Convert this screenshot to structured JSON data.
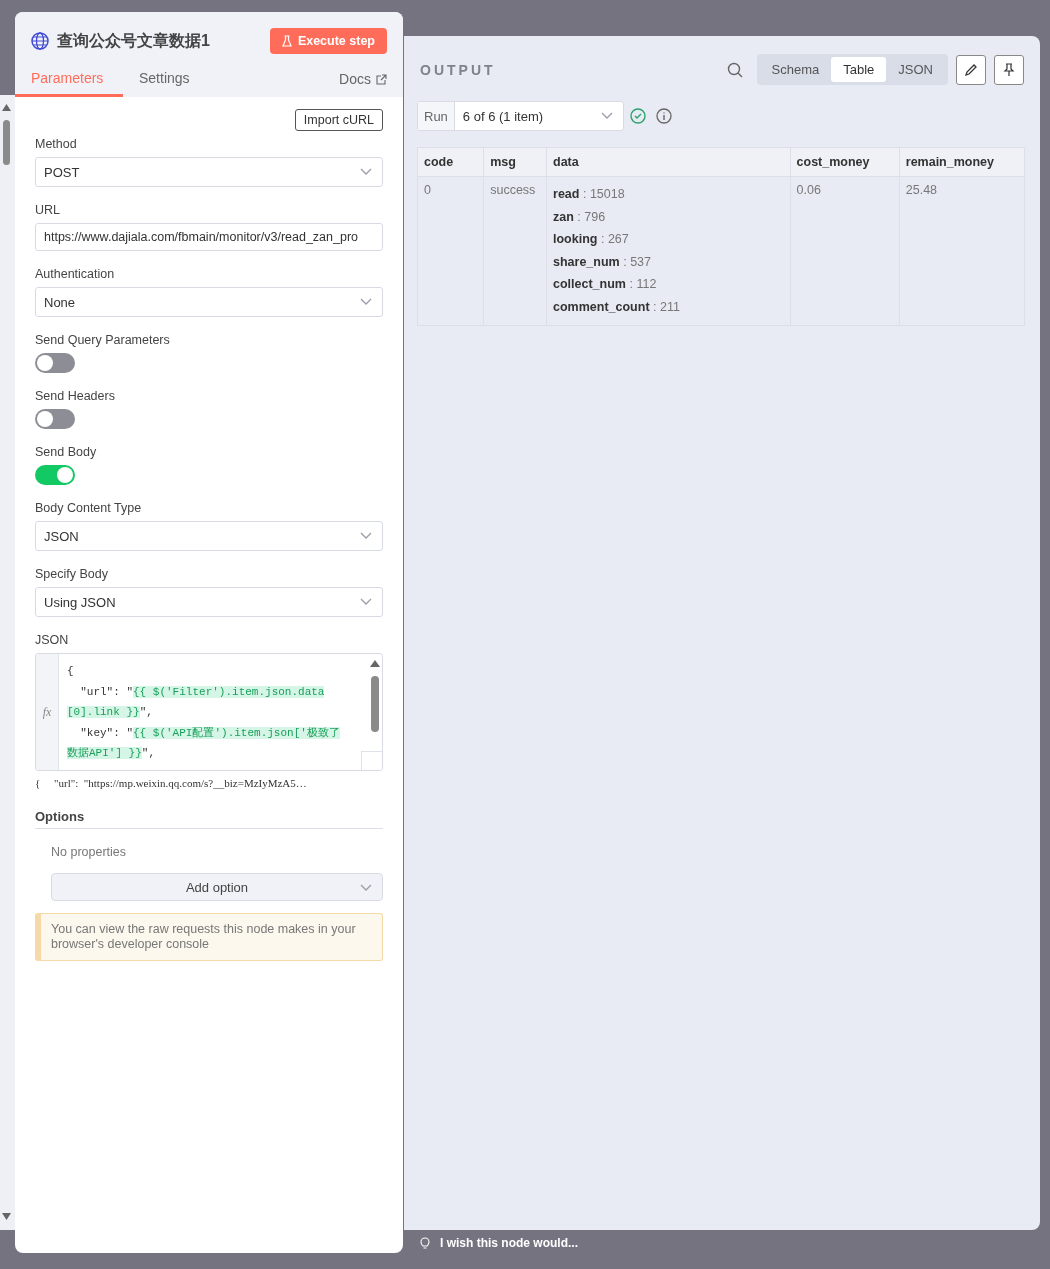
{
  "node": {
    "title": "查询公众号文章数据1",
    "execute_button": "Execute step"
  },
  "tabs": [
    {
      "label": "Parameters",
      "selected": true
    },
    {
      "label": "Settings",
      "selected": false
    }
  ],
  "docs_link": "Docs",
  "import_button": "Import cURL",
  "fields": [
    {
      "kind": "select",
      "label": "Method",
      "value": "POST"
    },
    {
      "kind": "input",
      "label": "URL",
      "value": "https://www.dajiala.com/fbmain/monitor/v3/read_zan_pro"
    },
    {
      "kind": "select",
      "label": "Authentication",
      "value": "None"
    },
    {
      "kind": "toggle",
      "label": "Send Query Parameters",
      "on": false
    },
    {
      "kind": "toggle",
      "label": "Send Headers",
      "on": false
    },
    {
      "kind": "toggle",
      "label": "Send Body",
      "on": true
    },
    {
      "kind": "select",
      "label": "Body Content Type",
      "value": "JSON"
    },
    {
      "kind": "select",
      "label": "Specify Body",
      "value": "Using JSON"
    }
  ],
  "json_editor": {
    "label": "JSON",
    "gutter": "fx",
    "lines": [
      [
        {
          "kind": "plain",
          "text": "{"
        }
      ],
      [
        {
          "kind": "plain",
          "text": "  \"url\": \""
        },
        {
          "kind": "expression",
          "text": "{{ $('Filter').item.json.data"
        }
      ],
      [
        {
          "kind": "expression",
          "text": "[0].link }}"
        },
        {
          "kind": "plain",
          "text": "\","
        }
      ],
      [
        {
          "kind": "plain",
          "text": "  \"key\": \""
        },
        {
          "kind": "expression",
          "text": "{{ $('API配置').item.json['极致了"
        }
      ],
      [
        {
          "kind": "expression",
          "text": "数据API'] }}"
        },
        {
          "kind": "plain",
          "text": "\","
        }
      ]
    ],
    "preview": "{     \"url\":  \"https://mp.weixin.qq.com/s?__biz=MzIyMzA5…"
  },
  "options": {
    "title": "Options",
    "empty_text": "No properties",
    "add_button": "Add option"
  },
  "notice": "You can view the raw requests this node makes in your browser's developer console",
  "output": {
    "title": "OUTPUT",
    "views": [
      {
        "label": "Schema",
        "selected": false
      },
      {
        "label": "Table",
        "selected": true
      },
      {
        "label": "JSON",
        "selected": false
      }
    ],
    "run_label": "Run",
    "run_value": "6 of 6 (1 item)",
    "table": {
      "columns": [
        "code",
        "msg",
        "data",
        "cost_money",
        "remain_money"
      ],
      "rows": [
        {
          "code": "0",
          "msg": "success",
          "data": [
            {
              "key": "read",
              "sep": ":",
              "value": "15018"
            },
            {
              "key": "zan",
              "sep": ":",
              "value": "796"
            },
            {
              "key": "looking",
              "sep": ":",
              "value": "267"
            },
            {
              "key": "share_num",
              "sep": ":",
              "value": "537"
            },
            {
              "key": "collect_num",
              "sep": ":",
              "value": "112"
            },
            {
              "key": "comment_count",
              "sep": ":",
              "value": "211"
            }
          ],
          "cost_money": "0.06",
          "remain_money": "25.48"
        }
      ]
    }
  },
  "feedback": "I wish this node would..."
}
